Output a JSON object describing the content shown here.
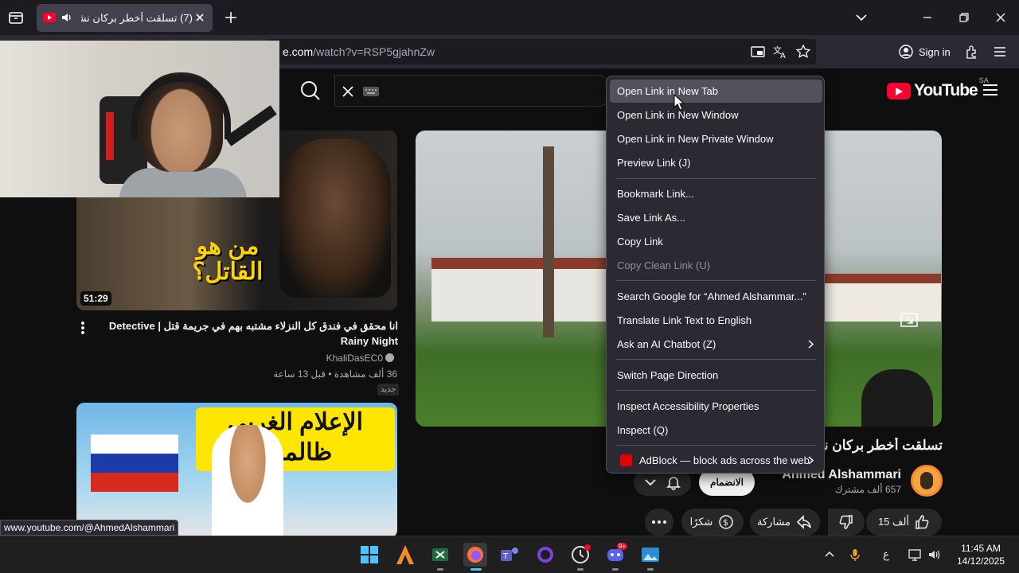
{
  "browser": {
    "tab_title": "(7) تسلقت أخطر بركان نشط",
    "url_prefix": "e.com",
    "url_path": "/watch?v=RSP5gjahnZw",
    "signin_label": "Sign in",
    "status_link": "www.youtube.com/@AhmedAlshammari"
  },
  "youtube": {
    "logo_text": "YouTube",
    "country_code": "SA"
  },
  "video1": {
    "duration": "51:29",
    "thumb_text": "من هو القاتل؟",
    "title": "انا محقق في فندق كل النزلاء مشتبه بهم في جريمة قتل | Detective Rainy Night",
    "channel": "KhaliDasEC0",
    "stats": "36 ألف مشاهدة • قبل 13 ساعة",
    "badge": "جديد"
  },
  "video2": {
    "thumb_text": "الإعلام الغربي ظالمها!"
  },
  "watch": {
    "title": "تسلقت أخطر بركان نشط",
    "channel": "Ahmed Alshammari",
    "subscribers": "657 ألف مشترك",
    "join_label": "الانضمام",
    "likes": "15 ألف",
    "share_label": "مشاركة",
    "thanks_label": "شكرًا"
  },
  "context_menu": {
    "items": [
      {
        "label": "Open Link in New Tab",
        "state": "hover"
      },
      {
        "label": "Open Link in New Window",
        "state": "normal"
      },
      {
        "label": "Open Link in New Private Window",
        "state": "normal"
      },
      {
        "label": "Preview Link (J)",
        "state": "normal"
      },
      {
        "label": "Bookmark Link...",
        "state": "normal"
      },
      {
        "label": "Save Link As...",
        "state": "normal"
      },
      {
        "label": "Copy Link",
        "state": "normal"
      },
      {
        "label": "Copy Clean Link (U)",
        "state": "disabled"
      },
      {
        "label": "Search Google for “Ahmed Alshammar...”",
        "state": "normal"
      },
      {
        "label": "Translate Link Text to English",
        "state": "normal"
      },
      {
        "label": "Ask an AI Chatbot (Z)",
        "state": "submenu"
      },
      {
        "label": "Switch Page Direction",
        "state": "normal"
      },
      {
        "label": "Inspect Accessibility Properties",
        "state": "normal"
      },
      {
        "label": "Inspect (Q)",
        "state": "normal"
      },
      {
        "label": "AdBlock — block ads across the web",
        "state": "submenu"
      }
    ]
  },
  "taskbar": {
    "time": "11:45 AM",
    "date": "14/12/2025",
    "lang": "ع",
    "discord_badge": "9+"
  },
  "colors": {
    "accent_red": "#ff0033",
    "menu_bg": "#2b2a33",
    "page_bg": "#0f0f0f"
  }
}
